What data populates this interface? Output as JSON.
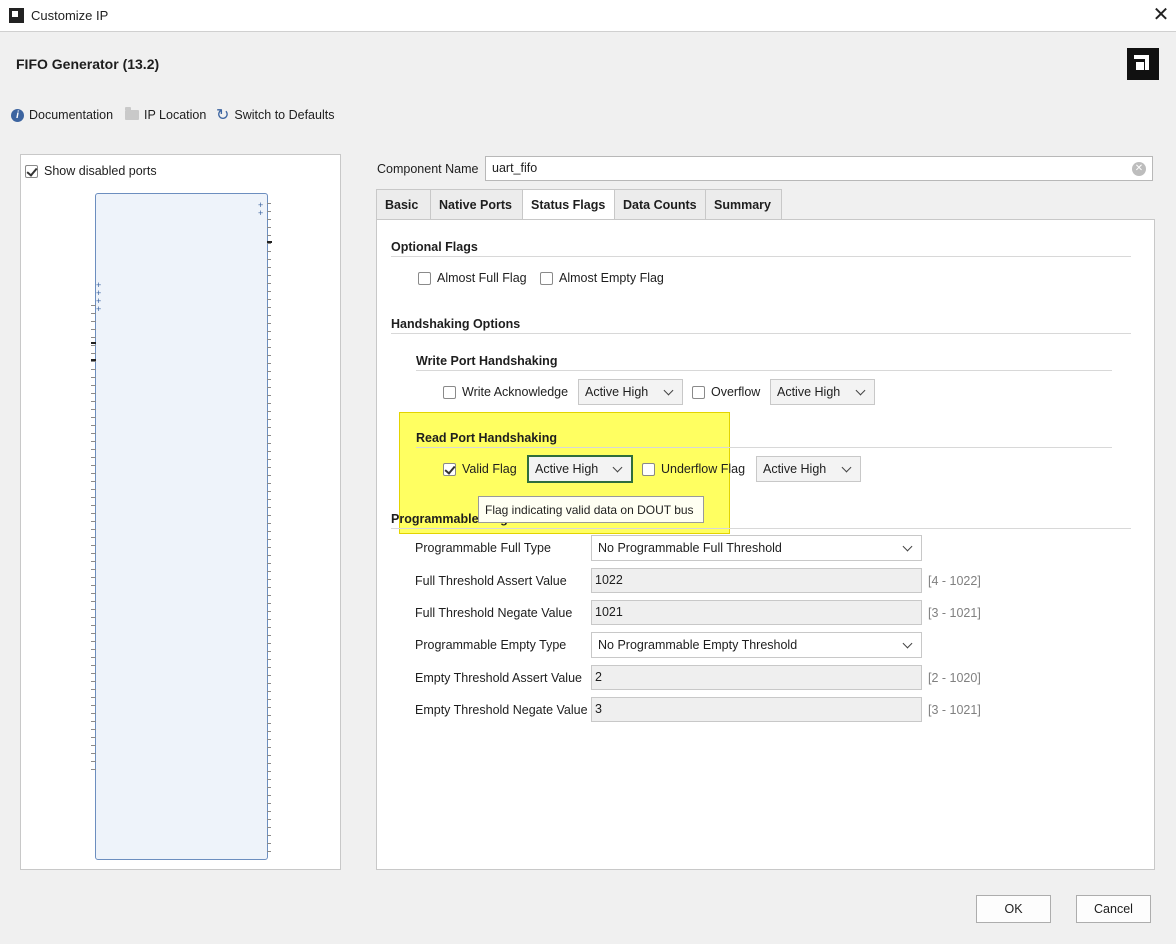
{
  "window": {
    "title": "Customize IP"
  },
  "header": {
    "title": "FIFO Generator (13.2)"
  },
  "toolbar": {
    "documentation": "Documentation",
    "ip_location": "IP Location",
    "switch_defaults": "Switch to Defaults"
  },
  "left_panel": {
    "show_disabled_ports": "Show disabled ports",
    "show_disabled_checked": true
  },
  "component": {
    "label": "Component Name",
    "value": "uart_fifo"
  },
  "tabs": [
    "Basic",
    "Native Ports",
    "Status Flags",
    "Data Counts",
    "Summary"
  ],
  "active_tab": "Status Flags",
  "optional_flags": {
    "heading": "Optional Flags",
    "almost_full": "Almost Full Flag",
    "almost_empty": "Almost Empty Flag"
  },
  "handshaking": {
    "heading": "Handshaking Options",
    "write_heading": "Write Port Handshaking",
    "write_ack": "Write Acknowledge",
    "write_ack_polarity": "Active High",
    "overflow": "Overflow",
    "overflow_polarity": "Active High",
    "read_heading": "Read Port Handshaking",
    "valid_flag": "Valid Flag",
    "valid_flag_checked": true,
    "valid_flag_polarity": "Active High",
    "underflow": "Underflow Flag",
    "underflow_polarity": "Active High"
  },
  "tooltip": "Flag indicating valid data on DOUT bus",
  "programmable": {
    "heading": "Programmable Flags",
    "rows": [
      {
        "label": "Programmable Full Type",
        "value": "No Programmable Full Threshold",
        "kind": "combo",
        "range": ""
      },
      {
        "label": "Full Threshold Assert Value",
        "value": "1022",
        "kind": "field",
        "range": "[4 - 1022]"
      },
      {
        "label": "Full Threshold Negate Value",
        "value": "1021",
        "kind": "field",
        "range": "[3 - 1021]"
      },
      {
        "label": "Programmable Empty Type",
        "value": "No Programmable Empty Threshold",
        "kind": "combo",
        "range": ""
      },
      {
        "label": "Empty Threshold Assert Value",
        "value": "2",
        "kind": "field",
        "range": "[2 - 1020]"
      },
      {
        "label": "Empty Threshold Negate Value",
        "value": "3",
        "kind": "field",
        "range": "[3 - 1021]"
      }
    ]
  },
  "buttons": {
    "ok": "OK",
    "cancel": "Cancel"
  },
  "colors": {
    "highlight": "#ffff00",
    "focus_border": "#2f6e3c",
    "accent": "#3c64a0"
  }
}
